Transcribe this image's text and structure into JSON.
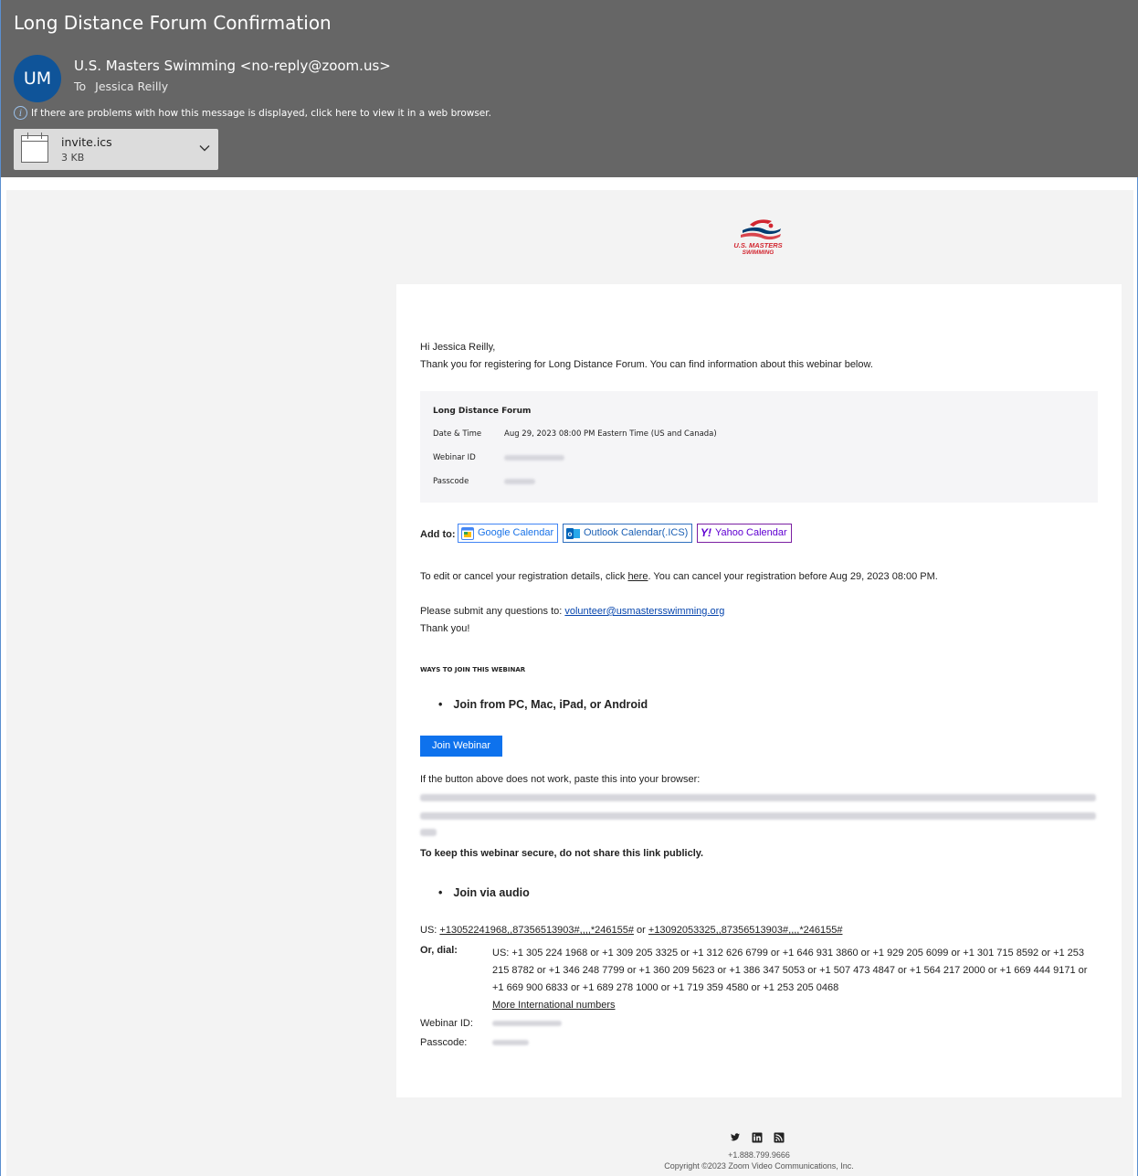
{
  "email": {
    "subject": "Long Distance Forum Confirmation",
    "avatar_initials": "UM",
    "from": "U.S. Masters Swimming <no-reply@zoom.us>",
    "to_label": "To",
    "to_name": "Jessica Reilly",
    "info_notice": "If there are problems with how this message is displayed, click here to view it in a web browser.",
    "attachment": {
      "name": "invite.ics",
      "size": "3 KB"
    }
  },
  "brand": {
    "logo_line1": "U.S. MASTERS",
    "logo_line2": "SWIMMING",
    "accent_red": "#d22630",
    "accent_blue": "#003c71"
  },
  "body": {
    "greeting": "Hi Jessica Reilly,",
    "thanks": "Thank you for registering for Long Distance Forum. You can find information about this webinar below.",
    "details": {
      "title": "Long Distance Forum",
      "date_label": "Date & Time",
      "date_value": "Aug 29, 2023 08:00 PM Eastern Time (US and Canada)",
      "webinar_id_label": "Webinar ID",
      "passcode_label": "Passcode"
    },
    "add_to_label": "Add to:",
    "calendars": {
      "google": "Google Calendar",
      "outlook": "Outlook Calendar(.ICS)",
      "yahoo": "Yahoo Calendar"
    },
    "edit_prefix": "To edit or cancel your registration details, click ",
    "edit_link": "here",
    "edit_suffix": ". You can cancel your registration before Aug 29, 2023 08:00 PM.",
    "questions_prefix": "Please submit any questions to: ",
    "questions_email": "volunteer@usmastersswimming.org",
    "thank_you": "Thank you!",
    "ways_heading": "WAYS TO JOIN THIS WEBINAR",
    "join_pc": "Join from PC, Mac, iPad, or Android",
    "join_button": "Join Webinar",
    "paste_text": "If the button above does not work, paste this into your browser:",
    "secure_text": "To keep this webinar secure, do not share this link publicly.",
    "join_audio": "Join via audio",
    "us_label": "US: ",
    "us_number1": "+13052241968,,87356513903#,,,,*246155#",
    "us_or": " or ",
    "us_number2": "+13092053325,,87356513903#,,,,*246155#",
    "or_dial_label": "Or, dial:",
    "dial_lines": [
      "US: +1 305 224 1968 or +1 309 205 3325 or +1 312 626 6799 or +1 646 931 3860 or +1 929 205 6099 or +1 301 715 8592 or +1 253",
      "215 8782 or +1 346 248 7799 or +1 360 209 5623 or +1 386 347 5053 or +1 507 473 4847 or +1 564 217 2000 or +1 669 444 9171 or",
      "+1 669 900 6833 or +1 689 278 1000 or +1 719 359 4580 or +1 253 205 0468"
    ],
    "more_intl": "More International numbers",
    "webinar_id_label2": "Webinar ID:",
    "passcode_label2": "Passcode:"
  },
  "footer": {
    "icons": [
      "twitter-icon",
      "linkedin-icon",
      "rss-icon"
    ],
    "phone": "+1.888.799.9666",
    "copyright": "Copyright ©2023 Zoom Video Communications, Inc."
  }
}
